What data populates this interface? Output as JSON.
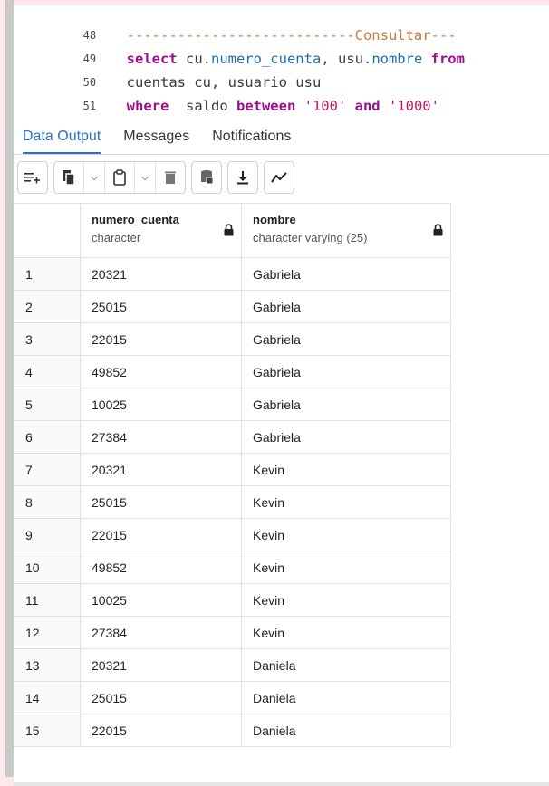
{
  "editor": {
    "lines": [
      {
        "num": "48",
        "text": "---------------------------Consultar---"
      },
      {
        "num": "49",
        "kw1": "select",
        "t1": " cu.",
        "col1": "numero_cuenta",
        "t2": ", usu.",
        "col2": "nombre",
        "kw2": " from"
      },
      {
        "num": "50",
        "text": "cuentas cu, usuario usu"
      },
      {
        "num": "51",
        "kw1": "where",
        "t1": "  saldo ",
        "kw2": "between",
        "str1": " '100'",
        "kw3": " and",
        "str2": " '1000'"
      }
    ]
  },
  "tabs": [
    {
      "label": "Data Output",
      "active": true
    },
    {
      "label": "Messages",
      "active": false
    },
    {
      "label": "Notifications",
      "active": false
    }
  ],
  "toolbar": {
    "icons": [
      "add-row-icon",
      "copy-icon",
      "paste-icon",
      "delete-icon",
      "save-data-icon",
      "download-icon",
      "graph-icon"
    ]
  },
  "grid": {
    "columns": [
      {
        "name": "numero_cuenta",
        "type": "character"
      },
      {
        "name": "nombre",
        "type": "character varying (25)"
      }
    ],
    "rows": [
      {
        "n": "1",
        "cuenta": "20321",
        "nombre": "Gabriela"
      },
      {
        "n": "2",
        "cuenta": "25015",
        "nombre": "Gabriela"
      },
      {
        "n": "3",
        "cuenta": "22015",
        "nombre": "Gabriela"
      },
      {
        "n": "4",
        "cuenta": "49852",
        "nombre": "Gabriela"
      },
      {
        "n": "5",
        "cuenta": "10025",
        "nombre": "Gabriela"
      },
      {
        "n": "6",
        "cuenta": "27384",
        "nombre": "Gabriela"
      },
      {
        "n": "7",
        "cuenta": "20321",
        "nombre": "Kevin"
      },
      {
        "n": "8",
        "cuenta": "25015",
        "nombre": "Kevin"
      },
      {
        "n": "9",
        "cuenta": "22015",
        "nombre": "Kevin"
      },
      {
        "n": "10",
        "cuenta": "49852",
        "nombre": "Kevin"
      },
      {
        "n": "11",
        "cuenta": "10025",
        "nombre": "Kevin"
      },
      {
        "n": "12",
        "cuenta": "27384",
        "nombre": "Kevin"
      },
      {
        "n": "13",
        "cuenta": "20321",
        "nombre": "Daniela"
      },
      {
        "n": "14",
        "cuenta": "25015",
        "nombre": "Daniela"
      },
      {
        "n": "15",
        "cuenta": "22015",
        "nombre": "Daniela"
      }
    ]
  },
  "colors": {
    "keyword": "#9a0f8e",
    "column": "#1c6ea8",
    "string": "#c2185b",
    "comment": "#c87a3c",
    "active_tab": "#2a6fc2"
  }
}
